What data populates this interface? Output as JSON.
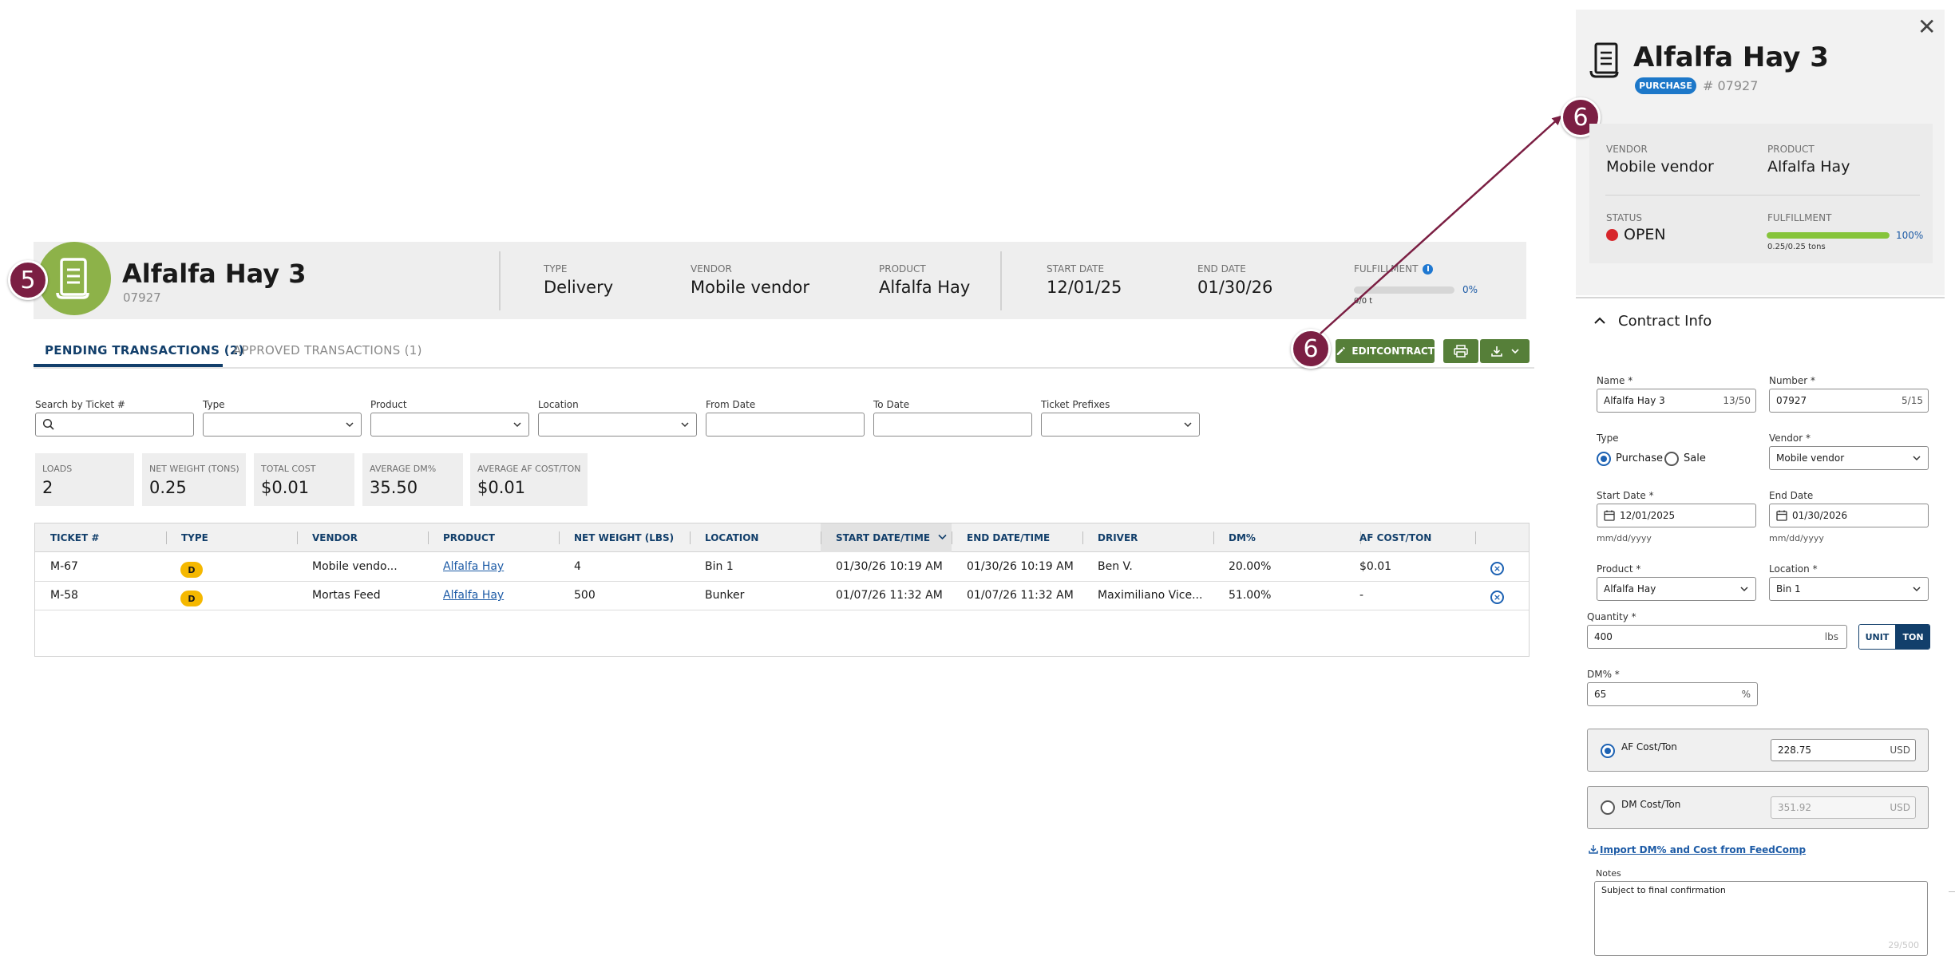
{
  "contract": {
    "title": "Alfalfa Hay 3",
    "number": "07927",
    "type_label": "TYPE",
    "type_value": "Delivery",
    "vendor_label": "VENDOR",
    "vendor_value": "Mobile vendor",
    "product_label": "PRODUCT",
    "product_value": "Alfalfa Hay",
    "start_label": "START DATE",
    "start_value": "12/01/25",
    "end_label": "END DATE",
    "end_value": "01/30/26",
    "fulfillment_label": "FULFILLMENT",
    "fulfillment_pct": "0%",
    "fulfillment_sub": "0/0 t",
    "fulfillment_fraction": 0
  },
  "callouts": {
    "five": "5",
    "six_a": "6",
    "six_b": "6"
  },
  "tabs": {
    "pending": "PENDING TRANSACTIONS (2)",
    "approved": "APPROVED TRANSACTIONS (1)"
  },
  "actions": {
    "edit_contract": "EDITCONTRACT"
  },
  "filters": {
    "search_label": "Search by Ticket #",
    "type_label": "Type",
    "product_label": "Product",
    "location_label": "Location",
    "from_label": "From Date",
    "to_label": "To Date",
    "prefix_label": "Ticket Prefixes"
  },
  "summary": [
    {
      "label": "LOADS",
      "value": "2"
    },
    {
      "label": "NET WEIGHT (TONS)",
      "value": "0.25"
    },
    {
      "label": "TOTAL COST",
      "value": "$0.01"
    },
    {
      "label": "AVERAGE DM%",
      "value": "35.50"
    },
    {
      "label": "AVERAGE AF COST/TON",
      "value": "$0.01"
    }
  ],
  "table": {
    "headers": [
      "TICKET #",
      "TYPE",
      "VENDOR",
      "PRODUCT",
      "NET WEIGHT (LBS)",
      "LOCATION",
      "START DATE/TIME",
      "END DATE/TIME",
      "DRIVER",
      "DM%",
      "AF COST/TON"
    ],
    "rows": [
      {
        "ticket": "M-67",
        "type": "D",
        "vendor": "Mobile vendo...",
        "product": "Alfalfa Hay",
        "net_weight": "4",
        "location": "Bin 1",
        "start": "01/30/26 10:19 AM",
        "end": "01/30/26 10:19 AM",
        "driver": "Ben V.",
        "dm": "20.00%",
        "af_cost": "$0.01"
      },
      {
        "ticket": "M-58",
        "type": "D",
        "vendor": "Mortas Feed",
        "product": "Alfalfa Hay",
        "net_weight": "500",
        "location": "Bunker",
        "start": "01/07/26 11:32 AM",
        "end": "01/07/26 11:32 AM",
        "driver": "Maximiliano Vice...",
        "dm": "51.00%",
        "af_cost": "-"
      }
    ]
  },
  "panel": {
    "title": "Alfalfa Hay 3",
    "type_pill": "PURCHASE",
    "number": "# 07927",
    "vendor_label": "VENDOR",
    "vendor_value": "Mobile vendor",
    "product_label": "PRODUCT",
    "product_value": "Alfalfa Hay",
    "status_label": "STATUS",
    "status_value": "OPEN",
    "fulfillment_label": "FULFILLMENT",
    "fulfillment_pct": "100%",
    "fulfillment_sub": "0.25/0.25 tons",
    "fulfillment_fraction": 1.0,
    "section_title": "Contract Info",
    "name_label": "Name *",
    "name_value": "Alfalfa Hay 3",
    "name_count": "13/50",
    "number_label": "Number *",
    "number_value": "07927",
    "number_count": "5/15",
    "type_label": "Type",
    "type_purchase": "Purchase",
    "type_sale": "Sale",
    "vendor_field_label": "Vendor *",
    "vendor_field_value": "Mobile vendor",
    "start_label": "Start Date *",
    "start_value": "12/01/2025",
    "end_label": "End Date",
    "end_value": "01/30/2026",
    "date_hint": "mm/dd/yyyy",
    "product_field_label": "Product *",
    "product_field_value": "Alfalfa Hay",
    "location_label": "Location *",
    "location_value": "Bin 1",
    "quantity_label": "Quantity *",
    "quantity_value": "400",
    "quantity_unit": "lbs",
    "toggle_unit": "UNIT",
    "toggle_ton": "TON",
    "dm_label": "DM% *",
    "dm_value": "65",
    "dm_unit": "%",
    "af_cost_label": "AF Cost/Ton",
    "af_cost_value": "228.75",
    "af_cost_currency": "USD",
    "dm_cost_label": "DM Cost/Ton",
    "dm_cost_value": "351.92",
    "dm_cost_currency": "USD",
    "import_link": "Import DM% and Cost from FeedComp",
    "notes_label": "Notes",
    "notes_value": "Subject to final confirmation",
    "notes_count": "29/500"
  },
  "colors": {
    "primary_navy": "#123f6b",
    "brand_green": "#567f39",
    "avatar_green": "#8db249",
    "callout": "#7b1f43",
    "link_blue": "#1d5ba6",
    "status_red": "#d7262b",
    "badge_yellow": "#f5b800"
  }
}
